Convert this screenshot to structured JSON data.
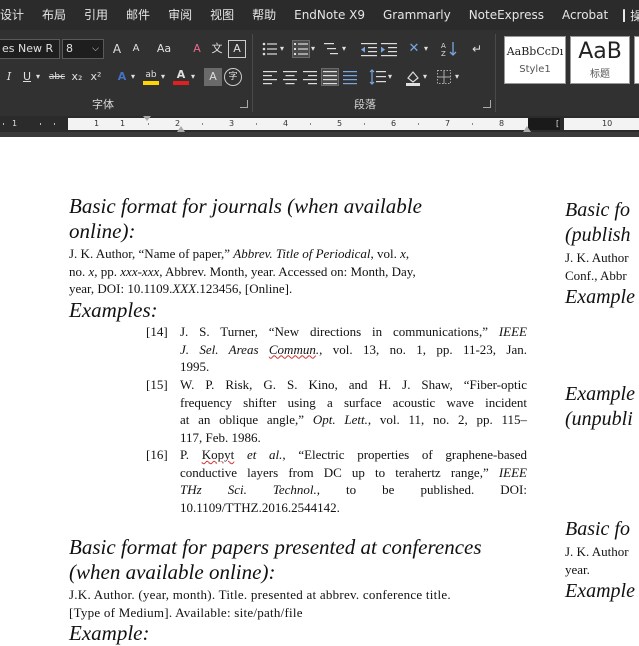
{
  "menu": {
    "tabs": [
      "设计",
      "布局",
      "引用",
      "邮件",
      "审阅",
      "视图",
      "帮助",
      "EndNote X9",
      "Grammarly",
      "NoteExpress",
      "Acrobat"
    ],
    "tell_me": "操作"
  },
  "ribbon": {
    "font_name": "es New R",
    "font_size": "8",
    "grow_font": "A",
    "shrink_font": "A",
    "change_case": "Aa",
    "clear_format": "A",
    "phonetic": "文",
    "char_border": "A",
    "italic": "I",
    "underline": "U",
    "strike": "abc",
    "subscript": "x₂",
    "superscript": "x²",
    "text_effects": "A",
    "highlight": "ab",
    "font_color": "A",
    "char_shading": "A",
    "enclose": "字",
    "font_group": "字体",
    "paragraph_group": "段落",
    "styles": [
      {
        "sample": "AaBbCcDı",
        "name": "Style1"
      },
      {
        "sample": "AaB",
        "name": "标题"
      }
    ],
    "colors": {
      "highlight": "#ffd500",
      "font_color": "#e02020",
      "text_effects": "#4472c4"
    }
  },
  "ruler": {
    "numbers_left": [
      "1",
      "1"
    ],
    "numbers": [
      "1",
      "2",
      "3",
      "4",
      "5",
      "6",
      "7",
      "8"
    ],
    "numbers_right": [
      "10"
    ]
  },
  "doc": {
    "journal_heading": [
      "Basic format for journals (when available",
      "online):"
    ],
    "journal_format": [
      [
        "J. K. Author, “Name of paper,” ",
        "Abbrev. Title of Periodical",
        ", vol. ",
        "x",
        ","
      ],
      [
        "no. ",
        "x",
        ", pp. ",
        "xxx-xxx",
        ", Abbrev. Month, year. Accessed on: Month, Day,"
      ],
      [
        "year, DOI: 10.1109.",
        "XXX",
        ".123456, [Online]."
      ]
    ],
    "examples_label": "Examples:",
    "refs": [
      {
        "num": "[14]",
        "lines": [
          "J. S. Turner, “New directions in communications,” IEEE",
          "J. Sel. Areas Commun., vol. 13, no. 1, pp. 11-23, Jan.",
          "1995."
        ]
      },
      {
        "num": "[15]",
        "lines": [
          "W. P. Risk, G. S. Kino, and H. J. Shaw, “Fiber-optic",
          "frequency shifter using a surface acoustic wave incident",
          "at an oblique angle,” Opt. Lett., vol. 11, no. 2, pp. 115–",
          "117, Feb. 1986."
        ]
      },
      {
        "num": "[16]",
        "lines": [
          "P. Kopyt et al., “Electric properties of graphene-based",
          "conductive layers from DC up to terahertz range,” IEEE",
          "THz Sci. Technol., to be published. DOI:",
          "10.1109/TTHZ.2016.2544142."
        ]
      }
    ],
    "ref_parts": {
      "r14_a": "J. S. Turner, “New directions in communications,” ",
      "r14_b": "IEEE",
      "r14_c": "J. Sel. Areas ",
      "r14_d": "Commun",
      "r14_e": ".",
      "r14_f": ", vol. 13, no. 1, pp. 11-23, Jan.",
      "r14_g": "1995.",
      "r15_a": "W. P. Risk, G. S. Kino, and H. J. Shaw, “Fiber-optic",
      "r15_b": "frequency shifter using a surface acoustic wave incident",
      "r15_c": "at an oblique angle,” ",
      "r15_d": "Opt. Lett.",
      "r15_e": ", vol. 11, no. 2, pp. 115–",
      "r15_f": "117, Feb. 1986.",
      "r16_a": "P. ",
      "r16_b": "Kopyt",
      "r16_c": " et al.,",
      "r16_d": " “Electric properties of graphene-based",
      "r16_e": "conductive layers from DC up to terahertz range,” ",
      "r16_f": "IEEE",
      "r16_g": "THz Sci. Technol.,",
      "r16_h": " to be published. DOI:",
      "r16_i": "10.1109/TTHZ.2016.2544142."
    },
    "conf_heading": [
      "Basic format for papers presented at conferences",
      "(when available online):"
    ],
    "conf_format": [
      "J.K. Author. (year, month). Title. presented at abbrev. conference title.",
      "[Type of Medium]. Available: site/path/file"
    ],
    "conf_examples": "Example:",
    "right_col": {
      "h1": "Basic fo",
      "h1b": "(publish",
      "t1": "J. K. Author",
      "t2": "Conf., Abbr",
      "e1": "Example",
      "e2": "Example",
      "h2b": "(unpubli",
      "h3": "Basic fo",
      "t3": "J. K. Author",
      "t4": "year.",
      "e3": "Example"
    }
  }
}
